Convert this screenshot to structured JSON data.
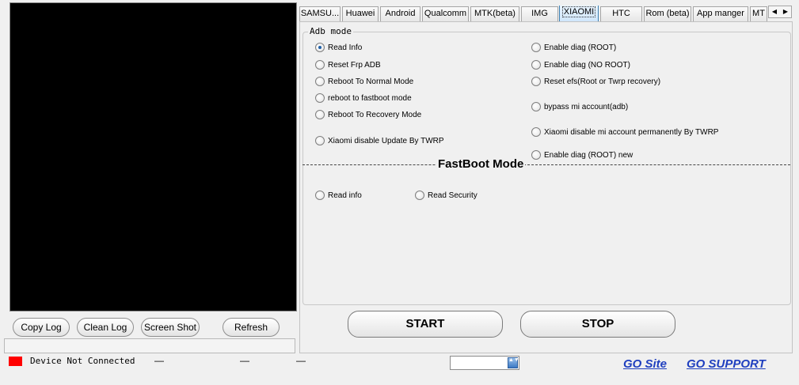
{
  "log_buttons": {
    "copy_log": "Copy Log",
    "clean_log": "Clean Log",
    "screen_shot": "Screen Shot",
    "refresh": "Refresh"
  },
  "status": {
    "text": "Device Not Connected",
    "led_color": "#ff0000",
    "dash1": "—",
    "dash2": "—",
    "dash3": "—"
  },
  "tabs": [
    "SAMSU...",
    "Huawei",
    "Android",
    "Qualcomm",
    "MTK(beta)",
    "IMG",
    "XIAOMI",
    "HTC",
    "Rom (beta)",
    "App manger",
    "MT"
  ],
  "active_tab": "XIAOMI",
  "tab_scroll": {
    "left": "◀",
    "right": "▶"
  },
  "adb_mode": {
    "legend": "Adb mode",
    "left_options": [
      "Read Info",
      "Reset Frp ADB",
      "Reboot To Normal Mode",
      "reboot to fastboot mode",
      "Reboot To Recovery Mode",
      "Xiaomi disable Update By TWRP"
    ],
    "right_options": [
      "Enable diag (ROOT)",
      "Enable diag (NO ROOT)",
      "Reset efs(Root or Twrp recovery)",
      "bypass mi account(adb)",
      "Xiaomi disable mi account permanently By TWRP",
      "Enable diag (ROOT) new"
    ],
    "selected": "Read Info"
  },
  "fastboot_mode": {
    "title": "FastBoot Mode",
    "options": [
      "Read info",
      "Read Security"
    ]
  },
  "actions": {
    "start": "START",
    "stop": "STOP"
  },
  "combo": {
    "value": "",
    "arrow": "▲▼"
  },
  "links": {
    "go_site": "GO Site",
    "go_support": "GO SUPPORT"
  },
  "colors": {
    "link": "#1f3fbf",
    "active_tab": "#cfe6fb",
    "log_bg": "#000000"
  }
}
